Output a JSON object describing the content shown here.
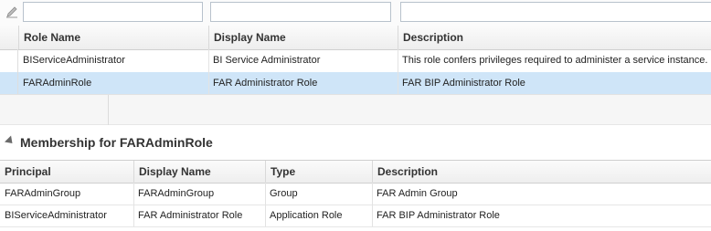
{
  "roles_table": {
    "columns": [
      "Role Name",
      "Display Name",
      "Description"
    ],
    "rows": [
      {
        "role_name": "BIServiceAdministrator",
        "display_name": "BI Service Administrator",
        "description": "This role confers privileges required to administer a service instance.",
        "selected": false
      },
      {
        "role_name": "FARAdminRole",
        "display_name": "FAR Administrator Role",
        "description": "FAR BIP Administrator Role",
        "selected": true
      }
    ],
    "filters": {
      "role_name": "",
      "display_name": "",
      "description": ""
    }
  },
  "membership": {
    "title": "Membership for FARAdminRole",
    "columns": [
      "Principal",
      "Display Name",
      "Type",
      "Description"
    ],
    "rows": [
      {
        "principal": "FARAdminGroup",
        "display_name": "FARAdminGroup",
        "type": "Group",
        "description": "FAR Admin Group"
      },
      {
        "principal": "BIServiceAdministrator",
        "display_name": "FAR Administrator Role",
        "type": "Application Role",
        "description": "FAR BIP Administrator Role"
      }
    ]
  },
  "colors": {
    "selection": "#cfe5f8",
    "header_bg": "#eeeeee"
  }
}
